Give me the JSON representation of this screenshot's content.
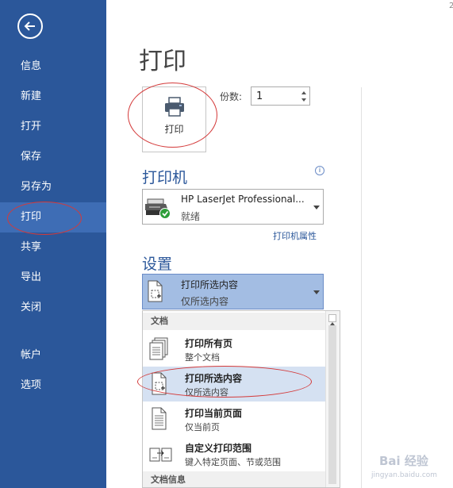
{
  "sidebar": {
    "items": [
      {
        "label": "信息"
      },
      {
        "label": "新建"
      },
      {
        "label": "打开"
      },
      {
        "label": "保存"
      },
      {
        "label": "另存为"
      },
      {
        "label": "打印",
        "active": true
      },
      {
        "label": "共享"
      },
      {
        "label": "导出"
      },
      {
        "label": "关闭"
      },
      {
        "label": "帐户"
      },
      {
        "label": "选项"
      }
    ]
  },
  "corner_digit": "2",
  "page": {
    "title": "打印",
    "print_button": "打印",
    "copies_label": "份数:",
    "copies_value": "1"
  },
  "printer": {
    "section": "打印机",
    "name": "HP LaserJet Professional...",
    "status": "就绪",
    "properties_link": "打印机属性"
  },
  "settings": {
    "section": "设置",
    "selected_title": "打印所选内容",
    "selected_sub": "仅所选内容"
  },
  "dropdown": {
    "header_document": "文档",
    "header_info": "文档信息",
    "items": [
      {
        "title": "打印所有页",
        "sub": "整个文档"
      },
      {
        "title": "打印所选内容",
        "sub": "仅所选内容",
        "selected": true
      },
      {
        "title": "打印当前页面",
        "sub": "仅当前页"
      },
      {
        "title": "自定义打印范围",
        "sub": "键入特定页面、节或范围"
      }
    ]
  },
  "watermark": {
    "main": "Bai 经验",
    "sub": "jingyan.baidu.com"
  },
  "colors": {
    "accent": "#2b579a",
    "selection": "#d5e1f2",
    "annotation": "#d43a3a"
  }
}
